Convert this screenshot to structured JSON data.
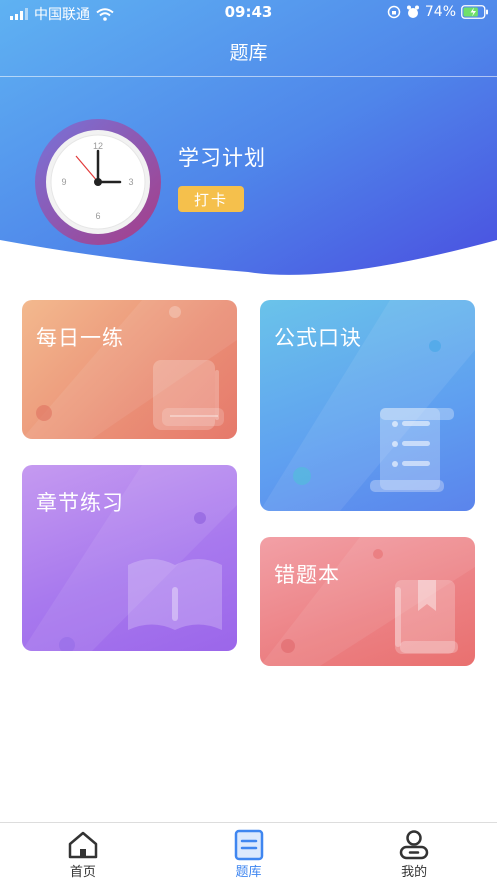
{
  "status_bar": {
    "carrier": "中国联通",
    "time": "09:43",
    "battery": "74%",
    "battery_level": 0.74
  },
  "header": {
    "title": "题库"
  },
  "plan": {
    "title": "学习计划",
    "punch_label": "打卡",
    "clock_numbers": [
      "12",
      "3",
      "6",
      "9"
    ]
  },
  "cards": {
    "daily": "每日一练",
    "formula": "公式口诀",
    "chapter": "章节练习",
    "wrong": "错题本"
  },
  "tab_bar": {
    "items": [
      {
        "label": "首页",
        "icon": "home-icon",
        "active": false
      },
      {
        "label": "题库",
        "icon": "question-bank-icon",
        "active": true
      },
      {
        "label": "我的",
        "icon": "profile-icon",
        "active": false
      }
    ]
  },
  "colors": {
    "header_gradient_start": "#5fb2f2",
    "header_gradient_end": "#4a4fe0",
    "accent": "#3f86f0",
    "punch_button": "#f5c04c"
  }
}
